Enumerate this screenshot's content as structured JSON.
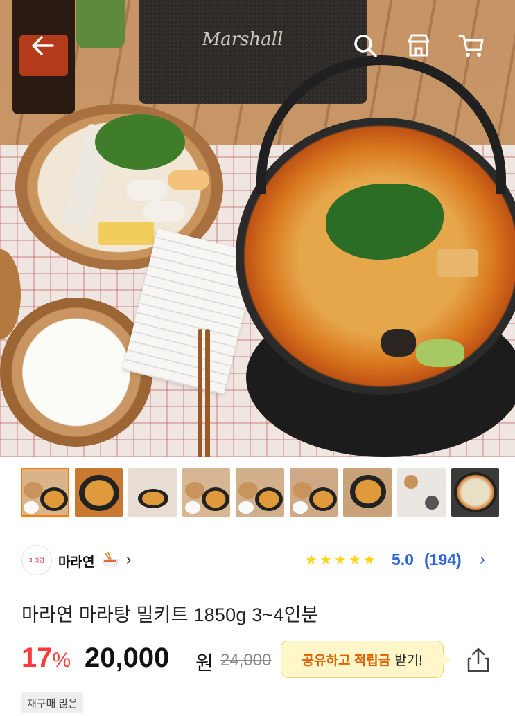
{
  "hero": {
    "speaker_brand": "Marshall"
  },
  "nav": {
    "back_icon": "back-arrow-icon",
    "search_icon": "search-icon",
    "home_icon": "store-home-icon",
    "cart_icon": "cart-icon"
  },
  "thumbnails": {
    "count": 9,
    "selected_index": 0
  },
  "store": {
    "logo_text": "마라연",
    "name": "마라연",
    "emoji": "🍜",
    "chevron": "›"
  },
  "rating": {
    "stars": 5,
    "score": "5.0",
    "count": "(194)",
    "chevron": "›"
  },
  "product": {
    "title": "마라연 마라탕 밀키트 1850g 3~4인분",
    "discount_value": "17",
    "discount_unit": "%",
    "price": "20,000",
    "price_unit": "원",
    "original_price": "24,000"
  },
  "share": {
    "highlight": "공유하고 적립금",
    "rest": "받기!",
    "icon": "share-icon"
  },
  "badge": {
    "label": "재구매 많은"
  },
  "colors": {
    "discount": "#ff3a3a",
    "rating": "#2f67d8",
    "star": "#ffd21f",
    "share_highlight": "#e06000",
    "share_bubble_bg": "#fff6c9",
    "selected_thumb": "#ff7a00"
  }
}
